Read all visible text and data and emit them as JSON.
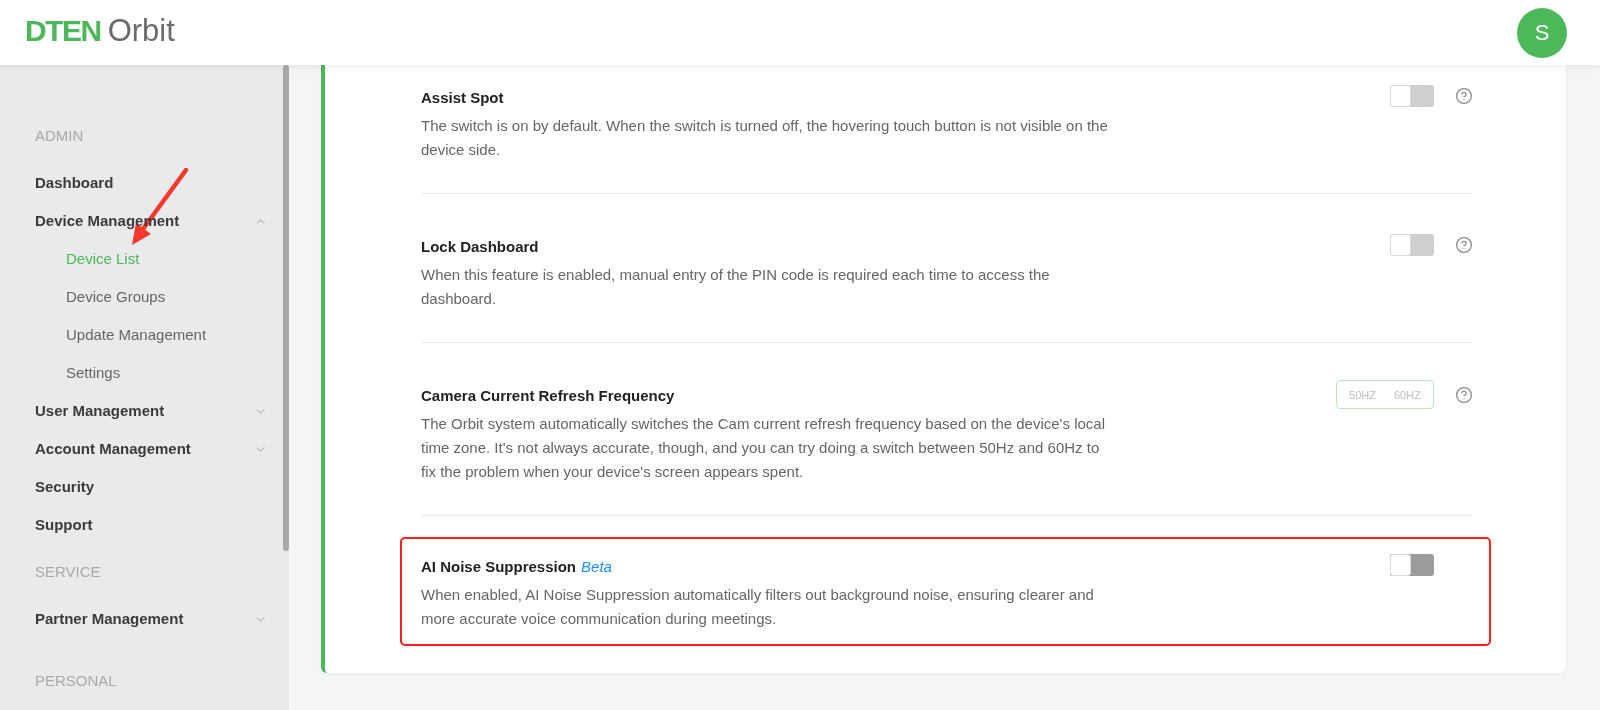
{
  "header": {
    "logo": {
      "brand": "DTEN",
      "product": "Orbit"
    },
    "avatar": {
      "initial": "S"
    }
  },
  "sidebar": {
    "sections": [
      {
        "label": "ADMIN",
        "items": [
          {
            "label": "Dashboard",
            "kind": "link",
            "selected": false
          },
          {
            "label": "Device Management",
            "kind": "group",
            "expanded": true,
            "selected": false,
            "children": [
              {
                "label": "Device List",
                "selected": true,
                "pointer_arrow": true
              },
              {
                "label": "Device Groups",
                "selected": false,
                "pointer_arrow": false
              },
              {
                "label": "Update Management",
                "selected": false,
                "pointer_arrow": false
              },
              {
                "label": "Settings",
                "selected": false,
                "pointer_arrow": false
              }
            ]
          },
          {
            "label": "User Management",
            "kind": "group",
            "expanded": false,
            "selected": false
          },
          {
            "label": "Account Management",
            "kind": "group",
            "expanded": false,
            "selected": false
          },
          {
            "label": "Security",
            "kind": "link",
            "selected": false
          },
          {
            "label": "Support",
            "kind": "link",
            "selected": false
          }
        ]
      },
      {
        "label": "SERVICE",
        "items": [
          {
            "label": "Partner Management",
            "kind": "group",
            "expanded": false,
            "selected": false
          }
        ]
      },
      {
        "label": "PERSONAL"
      }
    ]
  },
  "settings": [
    {
      "title": "Assist Spot",
      "description": "The switch is on by default. When the switch is turned off, the hovering touch button is not visible on the device side.",
      "control": {
        "kind": "toggle",
        "on": false,
        "disabled": true
      },
      "help_icon": true,
      "highlighted": false
    },
    {
      "title": "Lock Dashboard",
      "description": "When this feature is enabled, manual entry of the PIN code is required each time to access the dashboard.",
      "control": {
        "kind": "toggle",
        "on": false,
        "disabled": true
      },
      "help_icon": true,
      "highlighted": false
    },
    {
      "title": "Camera Current Refresh Frequency",
      "description": "The Orbit system automatically switches the Cam current refresh frequency based on the device's local time zone. It's not always accurate, though, and you can try doing a switch between 50Hz and 60Hz to fix the problem when your device's screen appears spent.",
      "control": {
        "kind": "segmented",
        "options": [
          {
            "label": "50HZ",
            "selected": false
          },
          {
            "label": "60HZ",
            "selected": false
          }
        ]
      },
      "help_icon": true,
      "highlighted": false
    },
    {
      "title": "AI Noise Suppression",
      "tag": "Beta",
      "description": "When enabled, AI Noise Suppression automatically filters out background noise, ensuring clearer and more accurate voice communication during meetings.",
      "control": {
        "kind": "toggle",
        "on": false,
        "disabled": false
      },
      "help_icon": false,
      "highlighted": true
    }
  ]
}
